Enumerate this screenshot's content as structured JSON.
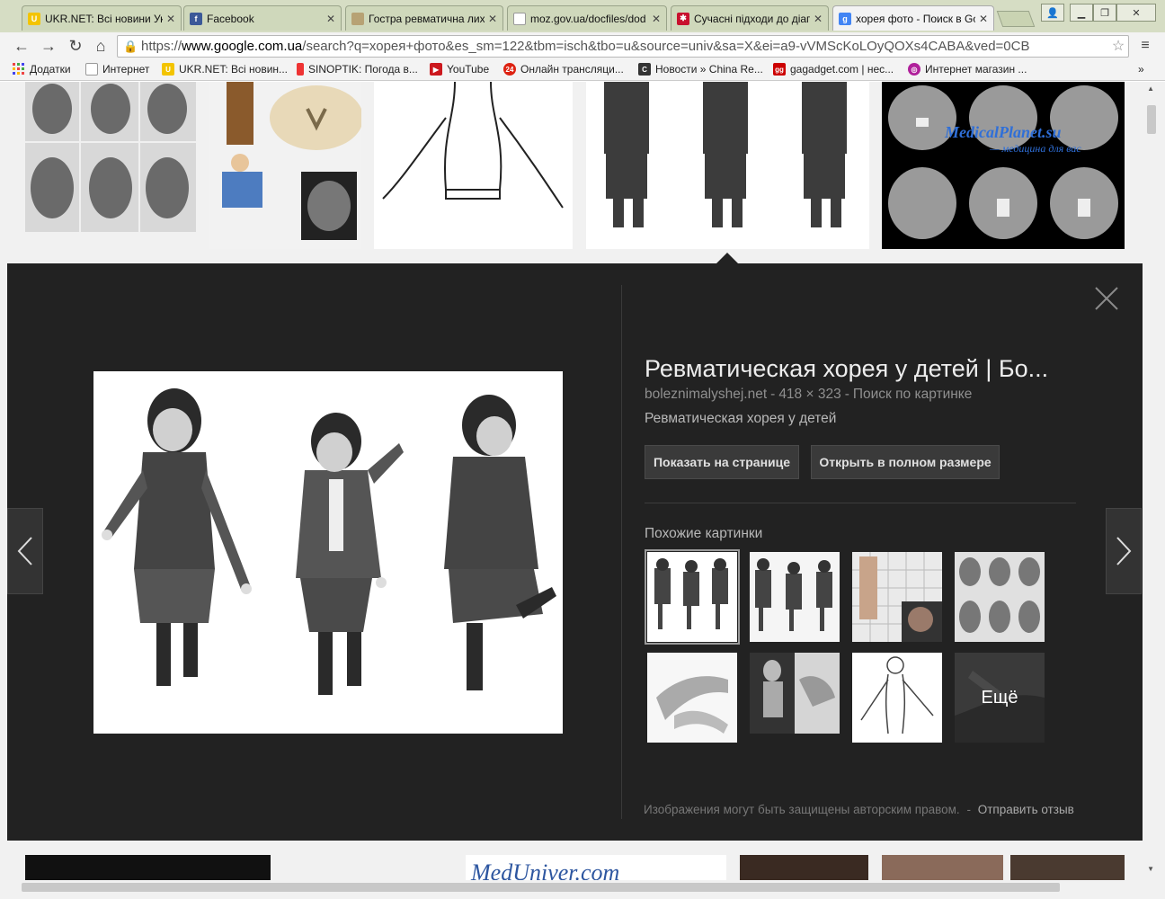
{
  "tabs": [
    {
      "title": "UKR.NET: Всі новини Україн",
      "icon": "ukrnet-icon",
      "color": "#f3c400"
    },
    {
      "title": "Facebook",
      "icon": "facebook-icon",
      "color": "#3b5998"
    },
    {
      "title": "Гостра ревматична лихомана",
      "icon": "page-icon",
      "color": "#b7a274"
    },
    {
      "title": "moz.gov.ua/docfiles/dod",
      "icon": "document-icon",
      "color": "#ffffff"
    },
    {
      "title": "Сучасні підходи до діагнос",
      "icon": "red-flag-icon",
      "color": "#c8102e"
    },
    {
      "title": "хорея фото - Поиск в Google",
      "icon": "google-icon",
      "color": "#4285f4",
      "active": true
    }
  ],
  "address": {
    "scheme": "https://",
    "host": "www.google.com.ua",
    "path": "/search?q=хорея+фото&es_sm=122&tbm=isch&tbo=u&source=univ&sa=X&ei=a9-vVMScKoLOyQOXs4CABA&ved=0CB"
  },
  "bookmarks": [
    {
      "label": "Додатки",
      "icon": "apps-grid-icon"
    },
    {
      "label": "Интернет",
      "icon": "document-icon"
    },
    {
      "label": "UKR.NET: Всі новин...",
      "icon": "ukrnet-icon"
    },
    {
      "label": "SINOPTIK: Погода в...",
      "icon": "thermometer-icon"
    },
    {
      "label": "YouTube",
      "icon": "youtube-icon"
    },
    {
      "label": "Онлайн трансляци...",
      "icon": "channel24-icon"
    },
    {
      "label": "Новости » China Re...",
      "icon": "chinareviews-icon"
    },
    {
      "label": "gagadget.com | нес...",
      "icon": "gagadget-icon"
    },
    {
      "label": "Интернет магазин ...",
      "icon": "shop-icon"
    }
  ],
  "bookmarks_overflow": "»",
  "preview": {
    "title": "Ревматическая хорея у детей | Бо...",
    "source": "boleznimalyshej.net",
    "dimensions": "418 × 323",
    "search_by_image": "Поиск по картинке",
    "sep": "-",
    "subtitle": "Ревматическая хорея у детей",
    "btn_show": "Показать на странице",
    "btn_open": "Открыть в полном размере",
    "similar_title": "Похожие картинки",
    "more_label": "Ещё",
    "copyright": "Изображения могут быть защищены авторским правом.",
    "feedback": "Отправить отзыв"
  },
  "watermarks": {
    "medicalplanet": "MedicalPlanet.su",
    "medicalplanet_sub": "— медицина для вас",
    "meduniver": "MedUniver.com"
  },
  "colors": {
    "panel_bg": "#222222",
    "chrome_bg": "#d6ddc4",
    "toolbar_bg": "#f3f3f3"
  }
}
